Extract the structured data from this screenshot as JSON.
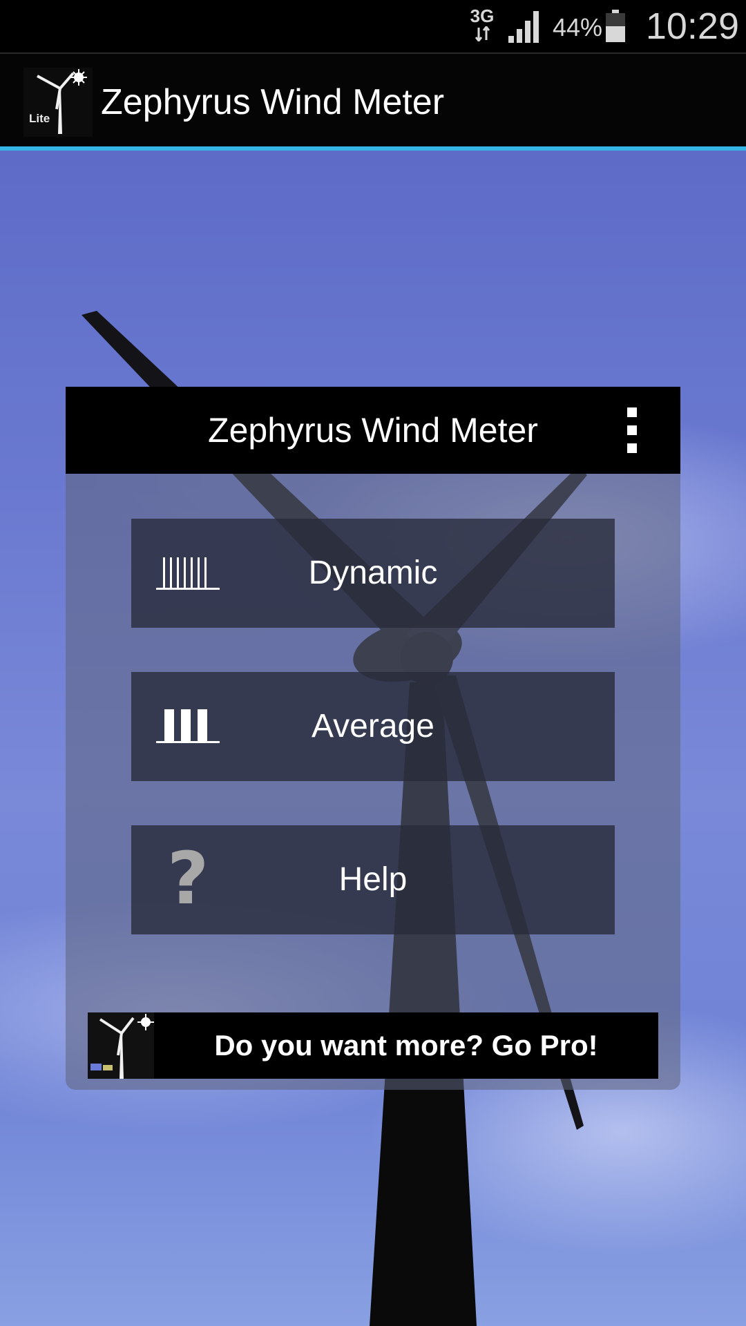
{
  "status_bar": {
    "network_type": "3G",
    "battery_percent": "44%",
    "time": "10:29",
    "icons": [
      "data-arrows-icon",
      "signal-icon",
      "battery-icon"
    ]
  },
  "app_bar": {
    "logo_badge": "Lite",
    "title": "Zephyrus Wind Meter",
    "accent_color": "#33b5e5"
  },
  "dialog": {
    "title": "Zephyrus Wind Meter",
    "menu_icon": "overflow-menu-icon",
    "buttons": [
      {
        "label": "Dynamic",
        "icon": "dynamic-bars-icon"
      },
      {
        "label": "Average",
        "icon": "average-bars-icon"
      },
      {
        "label": "Help",
        "icon": "help-icon",
        "glyph": "?"
      }
    ],
    "pro_banner": {
      "text": "Do you want more? Go Pro!",
      "icon": "pro-logo-icon"
    }
  }
}
